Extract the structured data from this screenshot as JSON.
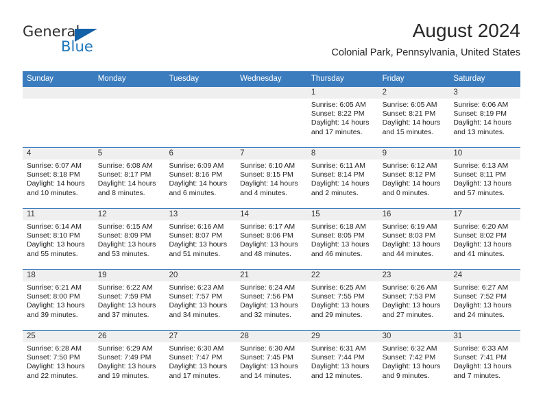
{
  "brand": {
    "name_part1": "General",
    "name_part2": "Blue",
    "accent_color": "#1b75bb",
    "triangle_color": "#1361a6"
  },
  "header": {
    "title": "August 2024",
    "location": "Colonial Park, Pennsylvania, United States"
  },
  "theme": {
    "header_band": "#3b7cbf",
    "date_band": "#efefef",
    "row_divider": "#3b7cbf"
  },
  "weekdays": [
    "Sunday",
    "Monday",
    "Tuesday",
    "Wednesday",
    "Thursday",
    "Friday",
    "Saturday"
  ],
  "weeks": [
    [
      {
        "day": "",
        "sunrise": "",
        "sunset": "",
        "daylight_line1": "",
        "daylight_line2": ""
      },
      {
        "day": "",
        "sunrise": "",
        "sunset": "",
        "daylight_line1": "",
        "daylight_line2": ""
      },
      {
        "day": "",
        "sunrise": "",
        "sunset": "",
        "daylight_line1": "",
        "daylight_line2": ""
      },
      {
        "day": "",
        "sunrise": "",
        "sunset": "",
        "daylight_line1": "",
        "daylight_line2": ""
      },
      {
        "day": "1",
        "sunrise": "Sunrise: 6:05 AM",
        "sunset": "Sunset: 8:22 PM",
        "daylight_line1": "Daylight: 14 hours",
        "daylight_line2": "and 17 minutes."
      },
      {
        "day": "2",
        "sunrise": "Sunrise: 6:05 AM",
        "sunset": "Sunset: 8:21 PM",
        "daylight_line1": "Daylight: 14 hours",
        "daylight_line2": "and 15 minutes."
      },
      {
        "day": "3",
        "sunrise": "Sunrise: 6:06 AM",
        "sunset": "Sunset: 8:19 PM",
        "daylight_line1": "Daylight: 14 hours",
        "daylight_line2": "and 13 minutes."
      }
    ],
    [
      {
        "day": "4",
        "sunrise": "Sunrise: 6:07 AM",
        "sunset": "Sunset: 8:18 PM",
        "daylight_line1": "Daylight: 14 hours",
        "daylight_line2": "and 10 minutes."
      },
      {
        "day": "5",
        "sunrise": "Sunrise: 6:08 AM",
        "sunset": "Sunset: 8:17 PM",
        "daylight_line1": "Daylight: 14 hours",
        "daylight_line2": "and 8 minutes."
      },
      {
        "day": "6",
        "sunrise": "Sunrise: 6:09 AM",
        "sunset": "Sunset: 8:16 PM",
        "daylight_line1": "Daylight: 14 hours",
        "daylight_line2": "and 6 minutes."
      },
      {
        "day": "7",
        "sunrise": "Sunrise: 6:10 AM",
        "sunset": "Sunset: 8:15 PM",
        "daylight_line1": "Daylight: 14 hours",
        "daylight_line2": "and 4 minutes."
      },
      {
        "day": "8",
        "sunrise": "Sunrise: 6:11 AM",
        "sunset": "Sunset: 8:14 PM",
        "daylight_line1": "Daylight: 14 hours",
        "daylight_line2": "and 2 minutes."
      },
      {
        "day": "9",
        "sunrise": "Sunrise: 6:12 AM",
        "sunset": "Sunset: 8:12 PM",
        "daylight_line1": "Daylight: 14 hours",
        "daylight_line2": "and 0 minutes."
      },
      {
        "day": "10",
        "sunrise": "Sunrise: 6:13 AM",
        "sunset": "Sunset: 8:11 PM",
        "daylight_line1": "Daylight: 13 hours",
        "daylight_line2": "and 57 minutes."
      }
    ],
    [
      {
        "day": "11",
        "sunrise": "Sunrise: 6:14 AM",
        "sunset": "Sunset: 8:10 PM",
        "daylight_line1": "Daylight: 13 hours",
        "daylight_line2": "and 55 minutes."
      },
      {
        "day": "12",
        "sunrise": "Sunrise: 6:15 AM",
        "sunset": "Sunset: 8:09 PM",
        "daylight_line1": "Daylight: 13 hours",
        "daylight_line2": "and 53 minutes."
      },
      {
        "day": "13",
        "sunrise": "Sunrise: 6:16 AM",
        "sunset": "Sunset: 8:07 PM",
        "daylight_line1": "Daylight: 13 hours",
        "daylight_line2": "and 51 minutes."
      },
      {
        "day": "14",
        "sunrise": "Sunrise: 6:17 AM",
        "sunset": "Sunset: 8:06 PM",
        "daylight_line1": "Daylight: 13 hours",
        "daylight_line2": "and 48 minutes."
      },
      {
        "day": "15",
        "sunrise": "Sunrise: 6:18 AM",
        "sunset": "Sunset: 8:05 PM",
        "daylight_line1": "Daylight: 13 hours",
        "daylight_line2": "and 46 minutes."
      },
      {
        "day": "16",
        "sunrise": "Sunrise: 6:19 AM",
        "sunset": "Sunset: 8:03 PM",
        "daylight_line1": "Daylight: 13 hours",
        "daylight_line2": "and 44 minutes."
      },
      {
        "day": "17",
        "sunrise": "Sunrise: 6:20 AM",
        "sunset": "Sunset: 8:02 PM",
        "daylight_line1": "Daylight: 13 hours",
        "daylight_line2": "and 41 minutes."
      }
    ],
    [
      {
        "day": "18",
        "sunrise": "Sunrise: 6:21 AM",
        "sunset": "Sunset: 8:00 PM",
        "daylight_line1": "Daylight: 13 hours",
        "daylight_line2": "and 39 minutes."
      },
      {
        "day": "19",
        "sunrise": "Sunrise: 6:22 AM",
        "sunset": "Sunset: 7:59 PM",
        "daylight_line1": "Daylight: 13 hours",
        "daylight_line2": "and 37 minutes."
      },
      {
        "day": "20",
        "sunrise": "Sunrise: 6:23 AM",
        "sunset": "Sunset: 7:57 PM",
        "daylight_line1": "Daylight: 13 hours",
        "daylight_line2": "and 34 minutes."
      },
      {
        "day": "21",
        "sunrise": "Sunrise: 6:24 AM",
        "sunset": "Sunset: 7:56 PM",
        "daylight_line1": "Daylight: 13 hours",
        "daylight_line2": "and 32 minutes."
      },
      {
        "day": "22",
        "sunrise": "Sunrise: 6:25 AM",
        "sunset": "Sunset: 7:55 PM",
        "daylight_line1": "Daylight: 13 hours",
        "daylight_line2": "and 29 minutes."
      },
      {
        "day": "23",
        "sunrise": "Sunrise: 6:26 AM",
        "sunset": "Sunset: 7:53 PM",
        "daylight_line1": "Daylight: 13 hours",
        "daylight_line2": "and 27 minutes."
      },
      {
        "day": "24",
        "sunrise": "Sunrise: 6:27 AM",
        "sunset": "Sunset: 7:52 PM",
        "daylight_line1": "Daylight: 13 hours",
        "daylight_line2": "and 24 minutes."
      }
    ],
    [
      {
        "day": "25",
        "sunrise": "Sunrise: 6:28 AM",
        "sunset": "Sunset: 7:50 PM",
        "daylight_line1": "Daylight: 13 hours",
        "daylight_line2": "and 22 minutes."
      },
      {
        "day": "26",
        "sunrise": "Sunrise: 6:29 AM",
        "sunset": "Sunset: 7:49 PM",
        "daylight_line1": "Daylight: 13 hours",
        "daylight_line2": "and 19 minutes."
      },
      {
        "day": "27",
        "sunrise": "Sunrise: 6:30 AM",
        "sunset": "Sunset: 7:47 PM",
        "daylight_line1": "Daylight: 13 hours",
        "daylight_line2": "and 17 minutes."
      },
      {
        "day": "28",
        "sunrise": "Sunrise: 6:30 AM",
        "sunset": "Sunset: 7:45 PM",
        "daylight_line1": "Daylight: 13 hours",
        "daylight_line2": "and 14 minutes."
      },
      {
        "day": "29",
        "sunrise": "Sunrise: 6:31 AM",
        "sunset": "Sunset: 7:44 PM",
        "daylight_line1": "Daylight: 13 hours",
        "daylight_line2": "and 12 minutes."
      },
      {
        "day": "30",
        "sunrise": "Sunrise: 6:32 AM",
        "sunset": "Sunset: 7:42 PM",
        "daylight_line1": "Daylight: 13 hours",
        "daylight_line2": "and 9 minutes."
      },
      {
        "day": "31",
        "sunrise": "Sunrise: 6:33 AM",
        "sunset": "Sunset: 7:41 PM",
        "daylight_line1": "Daylight: 13 hours",
        "daylight_line2": "and 7 minutes."
      }
    ]
  ]
}
